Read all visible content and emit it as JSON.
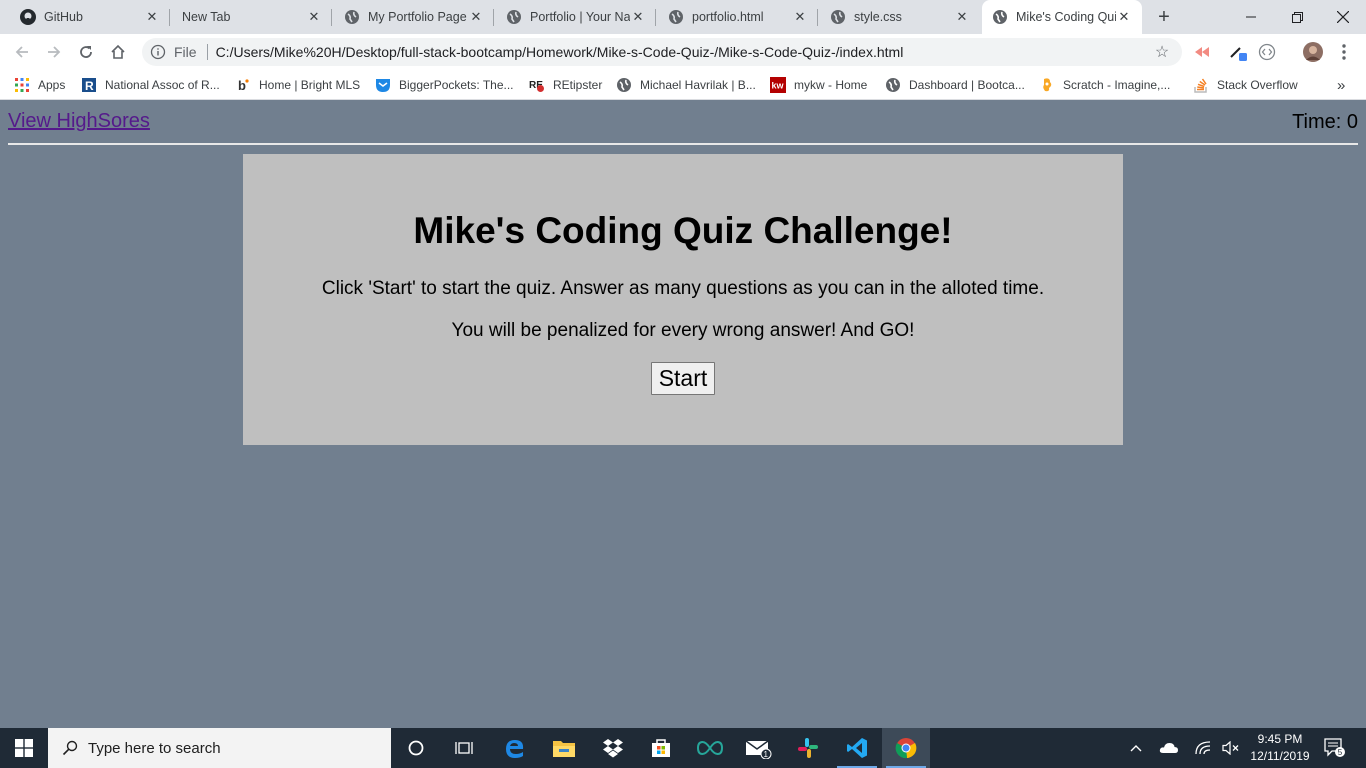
{
  "browser": {
    "tabs": [
      {
        "title": "GitHub",
        "icon": "github-icon"
      },
      {
        "title": "New Tab",
        "icon": "none"
      },
      {
        "title": "My Portfolio Page",
        "icon": "globe-icon"
      },
      {
        "title": "Portfolio | Your Na",
        "icon": "globe-icon"
      },
      {
        "title": "portfolio.html",
        "icon": "globe-icon"
      },
      {
        "title": "style.css",
        "icon": "globe-icon"
      },
      {
        "title": "Mike's Coding Qui",
        "icon": "globe-icon",
        "active": true
      }
    ],
    "new_tab": "+",
    "address": {
      "scheme": "File",
      "url": "C:/Users/Mike%20H/Desktop/full-stack-bootcamp/Homework/Mike-s-Code-Quiz-/Mike-s-Code-Quiz-/index.html"
    },
    "bookmarks": [
      {
        "label": "Apps",
        "icon": "apps-grid-icon"
      },
      {
        "label": "National Assoc of R...",
        "icon": "realtor-icon"
      },
      {
        "label": "Home | Bright MLS",
        "icon": "bright-mls-icon"
      },
      {
        "label": "BiggerPockets: The...",
        "icon": "biggerpockets-icon"
      },
      {
        "label": "REtipster",
        "icon": "retipster-icon"
      },
      {
        "label": "Michael Havrilak | B...",
        "icon": "globe-icon"
      },
      {
        "label": "mykw - Home",
        "icon": "kw-icon"
      },
      {
        "label": "Dashboard | Bootca...",
        "icon": "globe-icon"
      },
      {
        "label": "Scratch - Imagine,...",
        "icon": "scratch-icon"
      },
      {
        "label": "Stack Overflow",
        "icon": "stackoverflow-icon"
      }
    ],
    "bookmarks_overflow": "»"
  },
  "page": {
    "highscores_link": "View HighSores",
    "timer": "Time: 0",
    "title": "Mike's Coding Quiz Challenge!",
    "instructions_1": "Click 'Start' to start the quiz. Answer as many questions as you can in the alloted time.",
    "instructions_2": "You will be penalized for every wrong answer! And GO!",
    "start_label": "Start"
  },
  "taskbar": {
    "search_placeholder": "Type here to search",
    "mail_badge": "1",
    "time": "9:45 PM",
    "date": "12/11/2019",
    "notifications_count": "5"
  },
  "colors": {
    "page_bg": "#717f8f",
    "card_bg": "#bfbfbf",
    "link": "#551a8b",
    "taskbar_bg": "#1f2a36"
  }
}
